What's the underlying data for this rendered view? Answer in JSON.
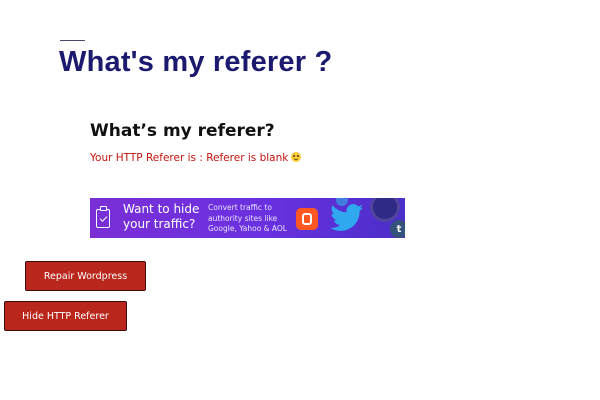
{
  "header": {
    "title": "What's my referer ?"
  },
  "content": {
    "heading": "What’s my referer?",
    "referer_text": "Your HTTP Referer is : Referer is blank"
  },
  "ad": {
    "headline": "Want to hide your traffic?",
    "subtext": "Convert traffic to authority sites like Google, Yahoo & AOL",
    "icons": [
      "clipboard-check-icon",
      "blogger-icon",
      "twitter-icon",
      "peace-icon",
      "tumblr-icon"
    ],
    "tumblr_letter": "t"
  },
  "buttons": {
    "repair_label": "Repair Wordpress",
    "hide_label": "Hide HTTP Referer"
  },
  "colors": {
    "title": "#1c1a6e",
    "referer_text": "#c0140c",
    "button_bg": "#b8261c",
    "ad_bg": "#6a30e0"
  }
}
